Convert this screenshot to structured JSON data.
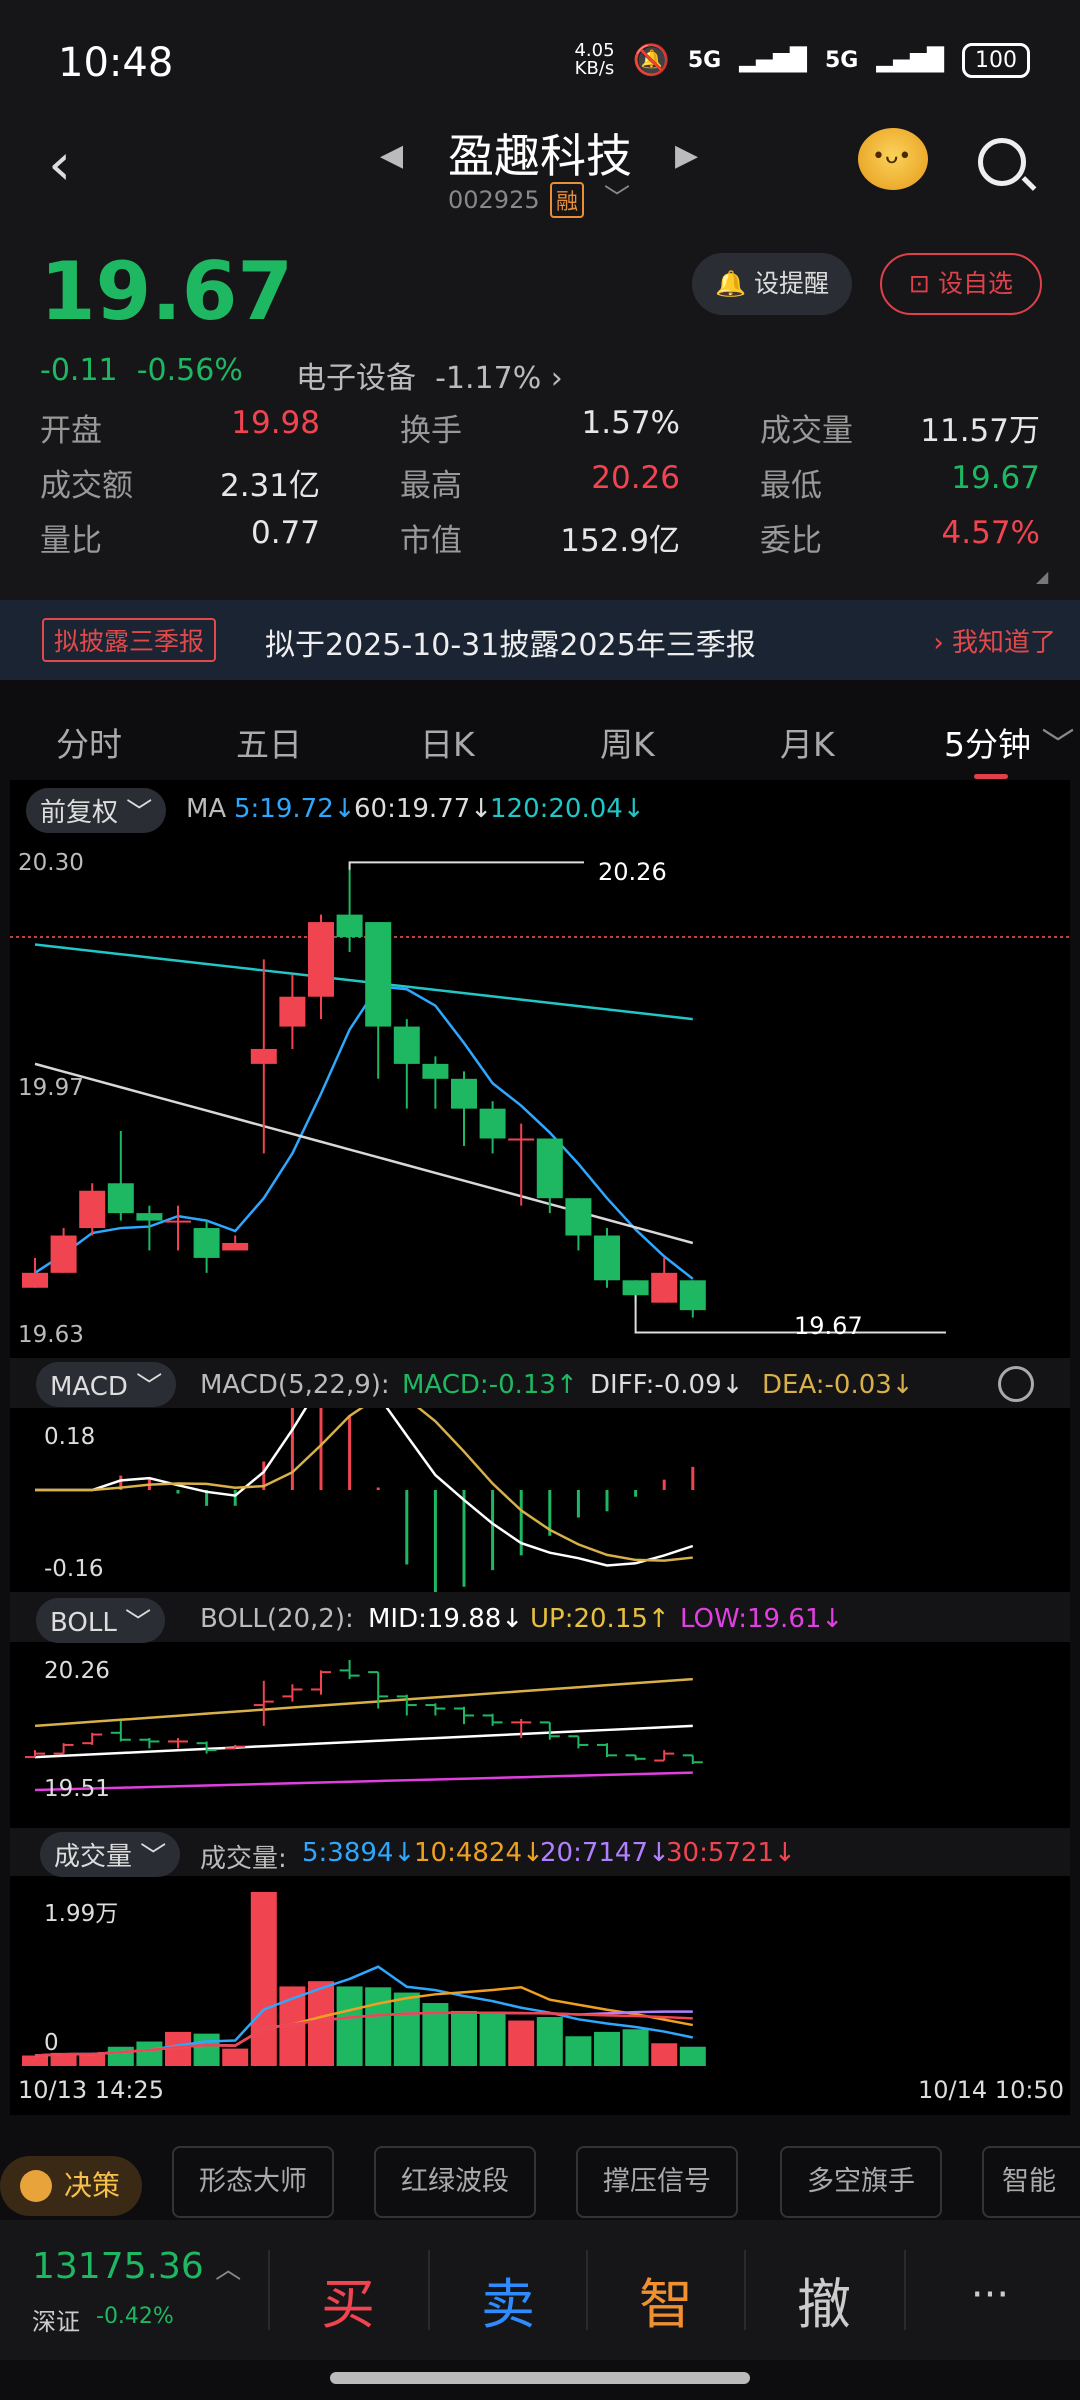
{
  "status": {
    "time": "10:48",
    "net_speed": "4.05",
    "net_unit": "KB/s",
    "signal1": "5G",
    "signal2": "5G",
    "battery": "100"
  },
  "header": {
    "title": "盈趣科技",
    "code": "002925",
    "margin_tag": "融"
  },
  "quote": {
    "price": "19.67",
    "change": "-0.11",
    "change_pct": "-0.56%",
    "industry": "电子设备",
    "industry_chg": "-1.17%",
    "alert_label": "设提醒",
    "fav_label": "设自选",
    "rows": [
      [
        {
          "k": "开盘",
          "v": "19.98",
          "c": "red"
        },
        {
          "k": "换手",
          "v": "1.57%",
          "c": "wht"
        },
        {
          "k": "成交量",
          "v": "11.57万",
          "c": "wht"
        }
      ],
      [
        {
          "k": "成交额",
          "v": "2.31亿",
          "c": "wht"
        },
        {
          "k": "最高",
          "v": "20.26",
          "c": "red"
        },
        {
          "k": "最低",
          "v": "19.67",
          "c": "green"
        }
      ],
      [
        {
          "k": "量比",
          "v": "0.77",
          "c": "wht"
        },
        {
          "k": "市值",
          "v": "152.9亿",
          "c": "wht"
        },
        {
          "k": "委比",
          "v": "4.57%",
          "c": "red"
        }
      ]
    ]
  },
  "notice": {
    "tag": "拟披露三季报",
    "text": "拟于2025-10-31披露2025年三季报",
    "action": "我知道了"
  },
  "tabs": [
    "分时",
    "五日",
    "日K",
    "周K",
    "月K",
    "5分钟"
  ],
  "kline": {
    "adjust": "前复权",
    "ma_label": "MA",
    "ma5": "5:19.72↓",
    "ma60": "60:19.77↓",
    "ma120": "120:20.04↓",
    "y_top": "20.30",
    "y_mid": "19.97",
    "y_bot": "19.63",
    "high_label": "20.26",
    "low_label": "19.67",
    "macd_name": "MACD",
    "macd_params": "MACD(5,22,9):",
    "macd_val": "MACD:-0.13↑",
    "diff_val": "DIFF:-0.09↓",
    "dea_val": "DEA:-0.03↓",
    "macd_top": "0.18",
    "macd_bot": "-0.16",
    "boll_name": "BOLL",
    "boll_params": "BOLL(20,2):",
    "boll_mid": "MID:19.88↓",
    "boll_up": "UP:20.15↑",
    "boll_low": "LOW:19.61↓",
    "boll_top": "20.26",
    "boll_bot": "19.51",
    "vol_name": "成交量",
    "vol_params": "成交量:",
    "vol5": "5:3894↓",
    "vol10": "10:4824↓",
    "vol20": "20:7147↓",
    "vol30": "30:5721↓",
    "vol_top": "1.99万",
    "vol_zero": "0",
    "t_start": "10/13 14:25",
    "t_end": "10/14 10:50"
  },
  "chart_data": {
    "type": "candlestick",
    "x_start": "10/13 14:25",
    "x_end": "10/14 10:50",
    "ylim": [
      19.63,
      20.3
    ],
    "candles": [
      {
        "o": 19.7,
        "c": 19.72,
        "h": 19.74,
        "l": 19.7
      },
      {
        "o": 19.72,
        "c": 19.77,
        "h": 19.78,
        "l": 19.72
      },
      {
        "o": 19.78,
        "c": 19.83,
        "h": 19.84,
        "l": 19.77
      },
      {
        "o": 19.84,
        "c": 19.8,
        "h": 19.91,
        "l": 19.79
      },
      {
        "o": 19.8,
        "c": 19.79,
        "h": 19.81,
        "l": 19.75
      },
      {
        "o": 19.79,
        "c": 19.79,
        "h": 19.81,
        "l": 19.75
      },
      {
        "o": 19.78,
        "c": 19.74,
        "h": 19.79,
        "l": 19.72
      },
      {
        "o": 19.75,
        "c": 19.76,
        "h": 19.77,
        "l": 19.75
      },
      {
        "o": 20.0,
        "c": 20.02,
        "h": 20.14,
        "l": 19.88
      },
      {
        "o": 20.05,
        "c": 20.09,
        "h": 20.12,
        "l": 20.02
      },
      {
        "o": 20.09,
        "c": 20.19,
        "h": 20.2,
        "l": 20.06
      },
      {
        "o": 20.2,
        "c": 20.17,
        "h": 20.26,
        "l": 20.15
      },
      {
        "o": 20.19,
        "c": 20.05,
        "h": 20.19,
        "l": 19.98
      },
      {
        "o": 20.05,
        "c": 20.0,
        "h": 20.06,
        "l": 19.94
      },
      {
        "o": 20.0,
        "c": 19.98,
        "h": 20.01,
        "l": 19.94
      },
      {
        "o": 19.98,
        "c": 19.94,
        "h": 19.99,
        "l": 19.89
      },
      {
        "o": 19.94,
        "c": 19.9,
        "h": 19.95,
        "l": 19.88
      },
      {
        "o": 19.9,
        "c": 19.9,
        "h": 19.92,
        "l": 19.81
      },
      {
        "o": 19.9,
        "c": 19.82,
        "h": 19.9,
        "l": 19.8
      },
      {
        "o": 19.82,
        "c": 19.77,
        "h": 19.82,
        "l": 19.75
      },
      {
        "o": 19.77,
        "c": 19.71,
        "h": 19.78,
        "l": 19.7
      },
      {
        "o": 19.71,
        "c": 19.69,
        "h": 19.71,
        "l": 19.68
      },
      {
        "o": 19.68,
        "c": 19.72,
        "h": 19.74,
        "l": 19.68
      },
      {
        "o": 19.71,
        "c": 19.67,
        "h": 19.71,
        "l": 19.66
      }
    ],
    "volume": [
      1200,
      1500,
      1400,
      2200,
      2800,
      3900,
      3700,
      1990,
      19900,
      9100,
      9700,
      9100,
      9000,
      8400,
      7200,
      6300,
      6200,
      5200,
      5600,
      3400,
      3900,
      4200,
      2600,
      2200
    ]
  },
  "toolbar": {
    "decide": "决策",
    "items": [
      "形态大师",
      "红绿波段",
      "撑压信号",
      "多空旗手",
      "智能"
    ]
  },
  "bottom": {
    "index_val": "13175.36",
    "index_name": "深证",
    "index_chg": "-0.42%",
    "buy": "买",
    "sell": "卖",
    "smart": "智",
    "cancel": "撤",
    "more": "···"
  },
  "colors": {
    "up": "#f04450",
    "down": "#1fb862",
    "ma5": "#2ea8ff",
    "ma60": "#d8d8d8",
    "ma120": "#22c6c6"
  }
}
